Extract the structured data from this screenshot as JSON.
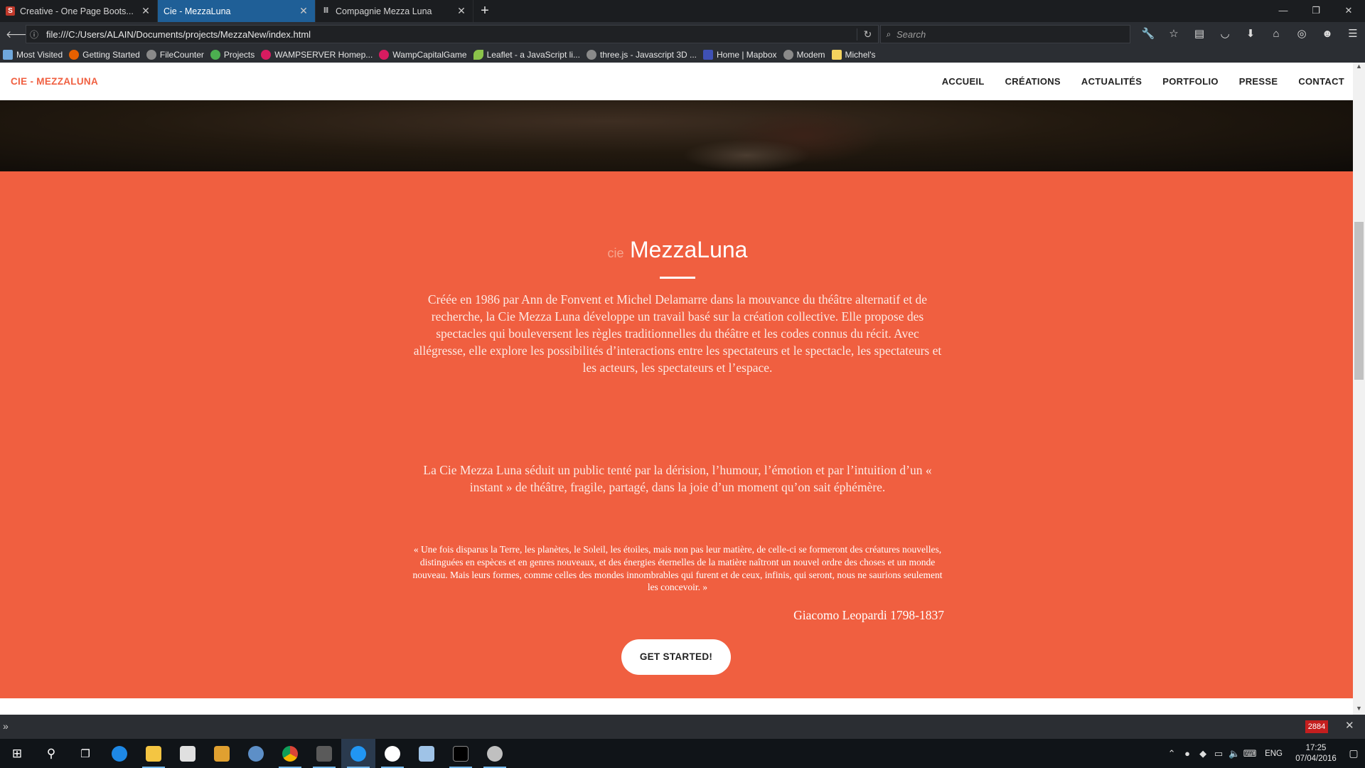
{
  "browser": {
    "tabs": [
      {
        "title": "Creative - One Page Boots...",
        "icon": "s-icon",
        "color": "#c0392b",
        "active": false
      },
      {
        "title": "Cie - MezzaLuna",
        "icon": "page-icon",
        "color": "#1f5f97",
        "active": true
      },
      {
        "title": "Compagnie Mezza Luna",
        "icon": "bars-icon",
        "color": "#cccccc",
        "active": false
      }
    ],
    "new_tab_label": "+",
    "url": "file:///C:/Users/ALAIN/Documents/projects/MezzaNew/index.html",
    "search_placeholder": "Search",
    "bookmarks": [
      {
        "label": "Most Visited",
        "color": "#6fa8dc"
      },
      {
        "label": "Getting Started",
        "color": "#e66000"
      },
      {
        "label": "FileCounter",
        "color": "#8a8a8a"
      },
      {
        "label": "Projects",
        "color": "#4caf50"
      },
      {
        "label": "WAMPSERVER Homep...",
        "color": "#d81b60"
      },
      {
        "label": "WampCapitalGame",
        "color": "#d81b60"
      },
      {
        "label": "Leaflet - a JavaScript li...",
        "color": "#8bc34a"
      },
      {
        "label": "three.js - Javascript 3D ...",
        "color": "#8a8a8a"
      },
      {
        "label": "Home | Mapbox",
        "color": "#3f51b5"
      },
      {
        "label": "Modem",
        "color": "#8a8a8a"
      },
      {
        "label": "Michel's",
        "color": "#f4d35e"
      }
    ]
  },
  "site": {
    "brand": "CIE - MEZZALUNA",
    "menu": [
      "ACCUEIL",
      "CRÉATIONS",
      "ACTUALITÉS",
      "PORTFOLIO",
      "PRESSE",
      "CONTACT"
    ],
    "accent": "#f05f40",
    "about": {
      "prefix": "cie",
      "title": "MezzaLuna",
      "paragraph1": "Créée en 1986 par Ann de Fonvent et Michel Delamarre dans la mouvance du théâtre alternatif et de recherche, la Cie Mezza Luna développe un travail basé sur la création collective. Elle propose des spectacles qui bouleversent les règles traditionnelles du théâtre et les codes connus du récit. Avec allégresse, elle explore les possibilités d’interactions entre les spectateurs et le spectacle, les spectateurs et les acteurs, les spectateurs et l’espace.",
      "paragraph2": "La Cie Mezza Luna séduit un public tenté par la dérision, l’humour, l’émotion et par l’intuition d’un « instant » de théâtre, fragile, partagé, dans la joie d’un moment qu’on sait éphémère.",
      "quote": "« Une fois disparus la Terre, les planètes, le Soleil, les étoiles, mais non pas leur matière, de celle-ci se formeront des créatures nouvelles, distinguées en espèces et en genres nouveaux, et des énergies éternelles de la matière naîtront un nouvel ordre des choses et un monde nouveau. Mais leurs formes, comme celles des mondes innombrables qui furent et de ceux, infinis, qui seront, nous ne saurions seulement les concevoir. »",
      "author": "Giacomo Leopardi 1798-1837",
      "cta": "GET STARTED!"
    }
  },
  "devbar": {
    "counter": "2884"
  },
  "taskbar": {
    "language": "ENG",
    "time": "17:25",
    "date": "07/04/2016"
  }
}
